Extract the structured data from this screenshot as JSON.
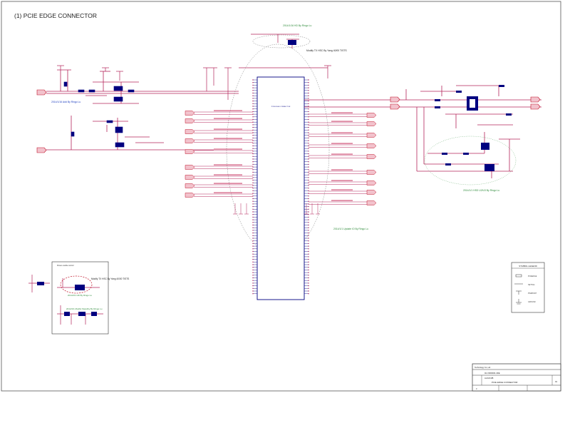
{
  "sheet": {
    "title": "(1) PCIE EDGE CONNECTOR"
  },
  "notes": {
    "top_green": "2014/1/16 HD By Ringo Lu",
    "top_black": "Modify TX HSC By Yang 40/00 TISTS",
    "left_blue": "2014/1/16 Add By Ringo Lu",
    "center_green": "2014/1/1 Update IO By Ringo Lu",
    "right_green": "2014/1/1 HSD U2/U3 By Ringo Lu",
    "inset_black": "Modify TX HSC By Yang 40/00 TISTS",
    "inset_green": "2014/1/1 HD By Ringo Lu",
    "inset_green_2": "2014/1/1 Modify Standby By Ringo Lu"
  },
  "connector": {
    "name": "PCIE EDGE CONNECTOR"
  },
  "legend": {
    "title": "SYMBOL LEGEND",
    "items": [
      "PCIEEDGE",
      "NETTAG",
      "PWRPORT",
      "GROUND"
    ]
  },
  "title_block": {
    "company": "Technology Co.,Ltd",
    "doc_number": "02-X000000-4DE",
    "project": "ALIGN MB",
    "sheet_name": "PCIE EDGE CONNECTOR",
    "rev": "01",
    "sheet_num": "3"
  },
  "colors": {
    "wire": "#b4245a",
    "part": "#000080",
    "note_green": "#2e8b3a",
    "note_blue": "#2040c0",
    "port_fill": "#f2c2cc",
    "port_stroke": "#c0142a",
    "power_text": "#c0142a"
  }
}
